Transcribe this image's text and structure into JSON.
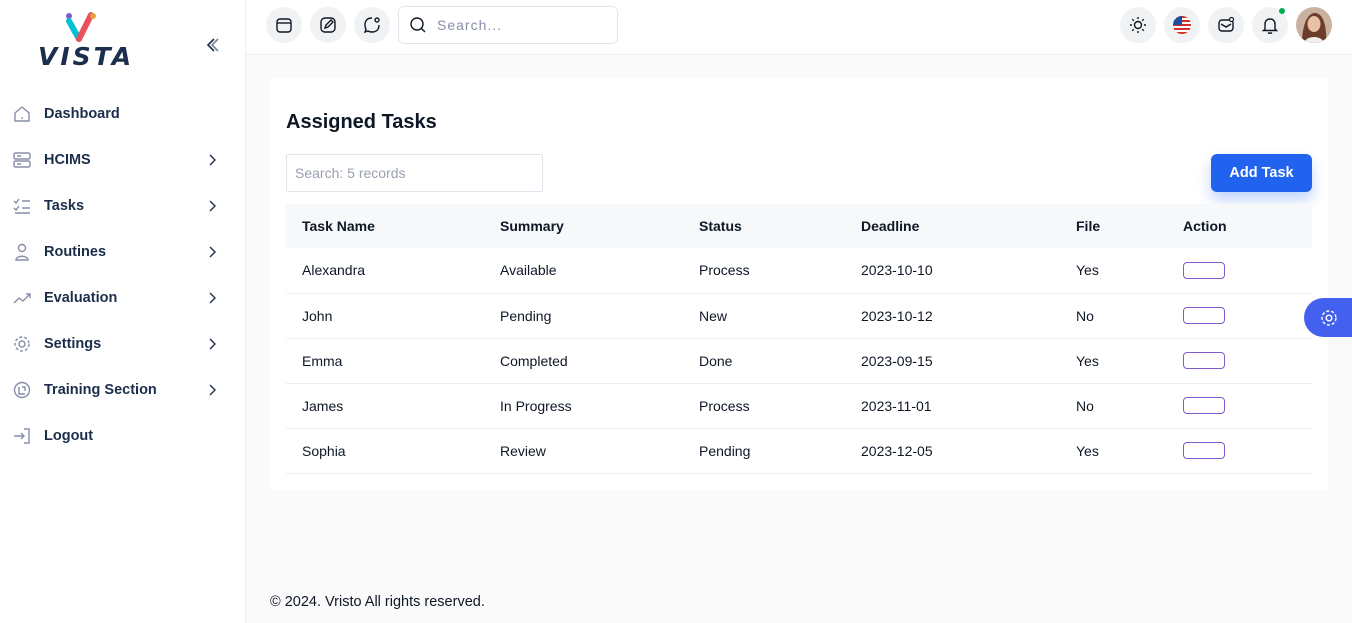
{
  "brand": {
    "name": "VISTA"
  },
  "sidebar": {
    "items": [
      {
        "label": "Dashboard",
        "icon": "home-icon",
        "has_submenu": false
      },
      {
        "label": "HCIMS",
        "icon": "server-icon",
        "has_submenu": true
      },
      {
        "label": "Tasks",
        "icon": "checklist-icon",
        "has_submenu": true
      },
      {
        "label": "Routines",
        "icon": "user-icon",
        "has_submenu": true
      },
      {
        "label": "Evaluation",
        "icon": "trend-up-icon",
        "has_submenu": true
      },
      {
        "label": "Settings",
        "icon": "gear-icon",
        "has_submenu": true
      },
      {
        "label": "Training Section",
        "icon": "training-icon",
        "has_submenu": true
      },
      {
        "label": "Logout",
        "icon": "logout-icon",
        "has_submenu": false
      }
    ]
  },
  "header": {
    "search_placeholder": "Search...",
    "icons": [
      "calendar-icon",
      "edit-icon",
      "chat-icon",
      "sun-icon",
      "us-flag-icon",
      "mail-icon",
      "bell-icon"
    ]
  },
  "main": {
    "title": "Assigned Tasks",
    "search_placeholder": "Search: 5 records",
    "add_button": "Add Task",
    "columns": [
      "Task Name",
      "Summary",
      "Status",
      "Deadline",
      "File",
      "Action"
    ],
    "rows": [
      {
        "name": "Alexandra",
        "summary": "Available",
        "status": "Process",
        "deadline": "2023-10-10",
        "file": "Yes"
      },
      {
        "name": "John",
        "summary": "Pending",
        "status": "New",
        "deadline": "2023-10-12",
        "file": "No"
      },
      {
        "name": "Emma",
        "summary": "Completed",
        "status": "Done",
        "deadline": "2023-09-15",
        "file": "Yes"
      },
      {
        "name": "James",
        "summary": "In Progress",
        "status": "Process",
        "deadline": "2023-11-01",
        "file": "No"
      },
      {
        "name": "Sophia",
        "summary": "Review",
        "status": "Pending",
        "deadline": "2023-12-05",
        "file": "Yes"
      }
    ]
  },
  "footer": {
    "text": "© 2024. Vristo All rights reserved."
  },
  "colors": {
    "primary": "#2163ef",
    "accent_purple": "#805dca",
    "float_button": "#4361ee",
    "online_dot": "#00ab55"
  }
}
